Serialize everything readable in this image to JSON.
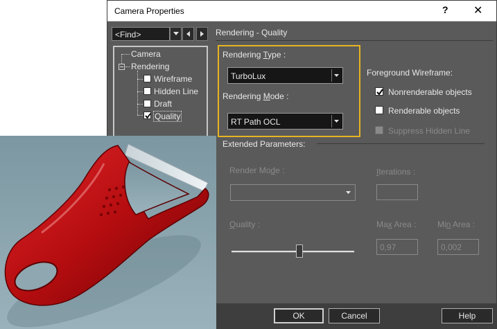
{
  "window": {
    "title": "Camera Properties",
    "help": "?",
    "close": "✕"
  },
  "toolbar": {
    "find_value": "<Find>"
  },
  "tree": {
    "root": "Camera",
    "group": "Rendering",
    "items": [
      {
        "label": "Wireframe",
        "checked": false
      },
      {
        "label": "Hidden Line",
        "checked": false
      },
      {
        "label": "Draft",
        "checked": false
      },
      {
        "label": "Quality",
        "checked": true
      }
    ]
  },
  "panel": {
    "section_title": "Rendering - Quality",
    "rendering_type_label_pre": "Rendering ",
    "rendering_type_label_u": "T",
    "rendering_type_label_post": "ype :",
    "rendering_type_value": "TurboLux",
    "rendering_mode_label_pre": "Rendering ",
    "rendering_mode_label_u": "M",
    "rendering_mode_label_post": "ode :",
    "rendering_mode_value": "RT Path OCL",
    "foreground_title": "Foreground Wireframe:",
    "nonrenderable_label": "Nonrenderable objects",
    "renderable_label": "Renderable objects",
    "suppress_label": "Suppress Hidden Line",
    "extended_title": "Extended Parameters:",
    "render_mode_label_pre": "Render Mo",
    "render_mode_label_u": "d",
    "render_mode_label_post": "e :",
    "iterations_label_pre": "",
    "iterations_label_u": "I",
    "iterations_label_post": "terations :",
    "quality_label_pre": "",
    "quality_label_u": "Q",
    "quality_label_post": "uality :",
    "max_area_label_pre": "Ma",
    "max_area_label_u": "x",
    "max_area_label_post": " Area :",
    "min_area_label_pre": "Mi",
    "min_area_label_u": "n",
    "min_area_label_post": " Area :",
    "max_area_value": "0,97",
    "min_area_value": "0,002"
  },
  "checkboxes": {
    "nonrenderable": true,
    "renderable": false,
    "suppress": false
  },
  "buttons": {
    "ok": "OK",
    "cancel": "Cancel",
    "help": "Help"
  },
  "colors": {
    "dialog_bg": "#5a5a5a",
    "highlight": "#e8b422",
    "peeler_red": "#b50d10",
    "backdrop": "#8aa3ad"
  }
}
